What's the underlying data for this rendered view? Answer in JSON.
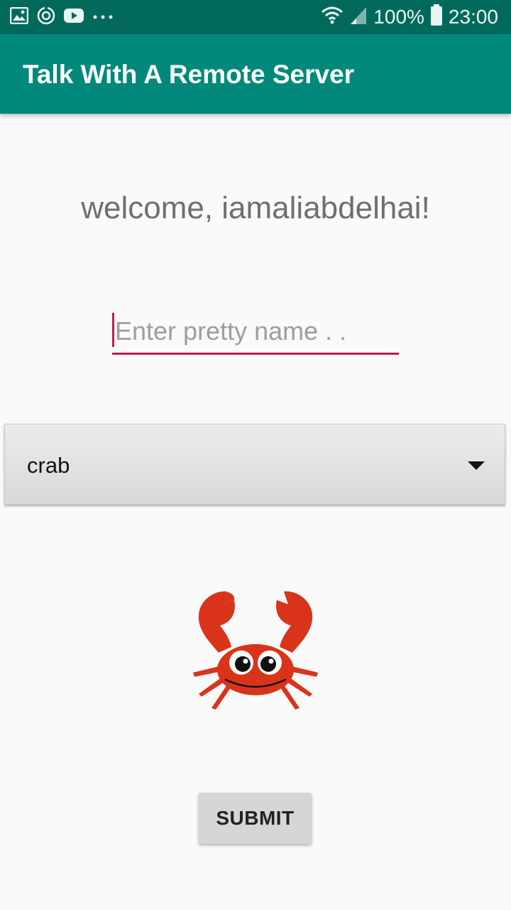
{
  "status_bar": {
    "icons_left": [
      "gallery-icon",
      "sync-icon",
      "youtube-icon",
      "more-dots-icon"
    ],
    "battery_percent": "100%",
    "time": "23:00"
  },
  "app_bar": {
    "title": "Talk With A Remote Server"
  },
  "welcome": {
    "text": "welcome, iamaliabdelhai!"
  },
  "name_input": {
    "placeholder": "Enter pretty name . .",
    "value": ""
  },
  "spinner": {
    "selected": "crab"
  },
  "submit": {
    "label": "SUBMIT"
  },
  "colors": {
    "status_bar": "#00695c",
    "app_bar": "#00897b",
    "accent": "#c2185b",
    "crab": "#d9341a"
  }
}
